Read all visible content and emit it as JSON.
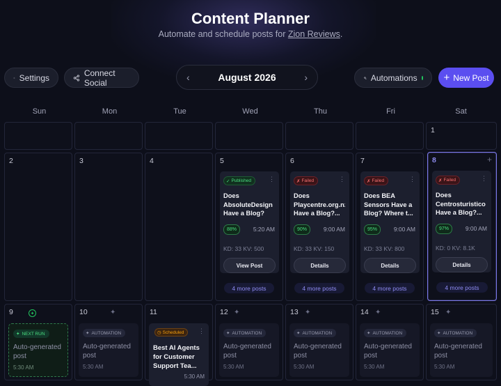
{
  "header": {
    "title": "Content Planner",
    "subtitle_prefix": "Automate and schedule posts for ",
    "subtitle_link": "Zion Reviews",
    "subtitle_suffix": "."
  },
  "toolbar": {
    "settings_label": "Settings",
    "connect_label": "Connect Social",
    "month_label": "August 2026",
    "automations_label": "Automations",
    "new_post_label": "New Post",
    "prev_icon": "chevron-left-icon",
    "next_icon": "chevron-right-icon",
    "status_color": "#22c55e",
    "accent_color": "#5b4ef0"
  },
  "weekdays": [
    "Sun",
    "Mon",
    "Tue",
    "Wed",
    "Thu",
    "Fri",
    "Sat"
  ],
  "week1": {
    "sat": "1"
  },
  "week2": {
    "days": [
      "2",
      "3",
      "4",
      "5",
      "6",
      "7",
      "8"
    ],
    "wed": {
      "status": "Published",
      "title_1": "Does",
      "title_2": "AbsoluteDesign",
      "title_3": "Have a Blog?",
      "score": "88%",
      "time": "5:20 AM",
      "kdkv": "KD: 33 KV: 500",
      "button": "View Post",
      "more": "4 more posts"
    },
    "thu": {
      "status": "Failed",
      "title_1": "Does",
      "title_2": "Playcentre.org.nz",
      "title_3": "Have a Blog?...",
      "score": "90%",
      "time": "9:00 AM",
      "kdkv": "KD: 33 KV: 150",
      "button": "Details",
      "more": "4 more posts"
    },
    "fri": {
      "status": "Failed",
      "title_1": "Does BEA",
      "title_2": "Sensors Have a",
      "title_3": "Blog? Where t...",
      "score": "95%",
      "time": "9:00 AM",
      "kdkv": "KD: 33 KV: 800",
      "button": "Details",
      "more": "4 more posts"
    },
    "sat": {
      "status": "Failed",
      "title_1": "Does",
      "title_2": "Centrosturistico",
      "title_3": "Have a Blog?...",
      "score": "97%",
      "time": "9:00 AM",
      "kdkv": "KD: 0 KV: 8.1K",
      "button": "Details",
      "more": "4 more posts"
    }
  },
  "week3": {
    "days": [
      "9",
      "10",
      "11",
      "12",
      "13",
      "14",
      "15"
    ],
    "next_run_label": "NEXT RUN",
    "automation_label": "AUTOMATION",
    "auto_title_1": "Auto-generated",
    "auto_title_2": "post",
    "auto_time": "5:30 AM",
    "scheduled": {
      "status": "Scheduled",
      "title_1": "Best AI Agents",
      "title_2": "for Customer",
      "title_3": "Support Tea...",
      "time": "5:30 AM"
    }
  }
}
